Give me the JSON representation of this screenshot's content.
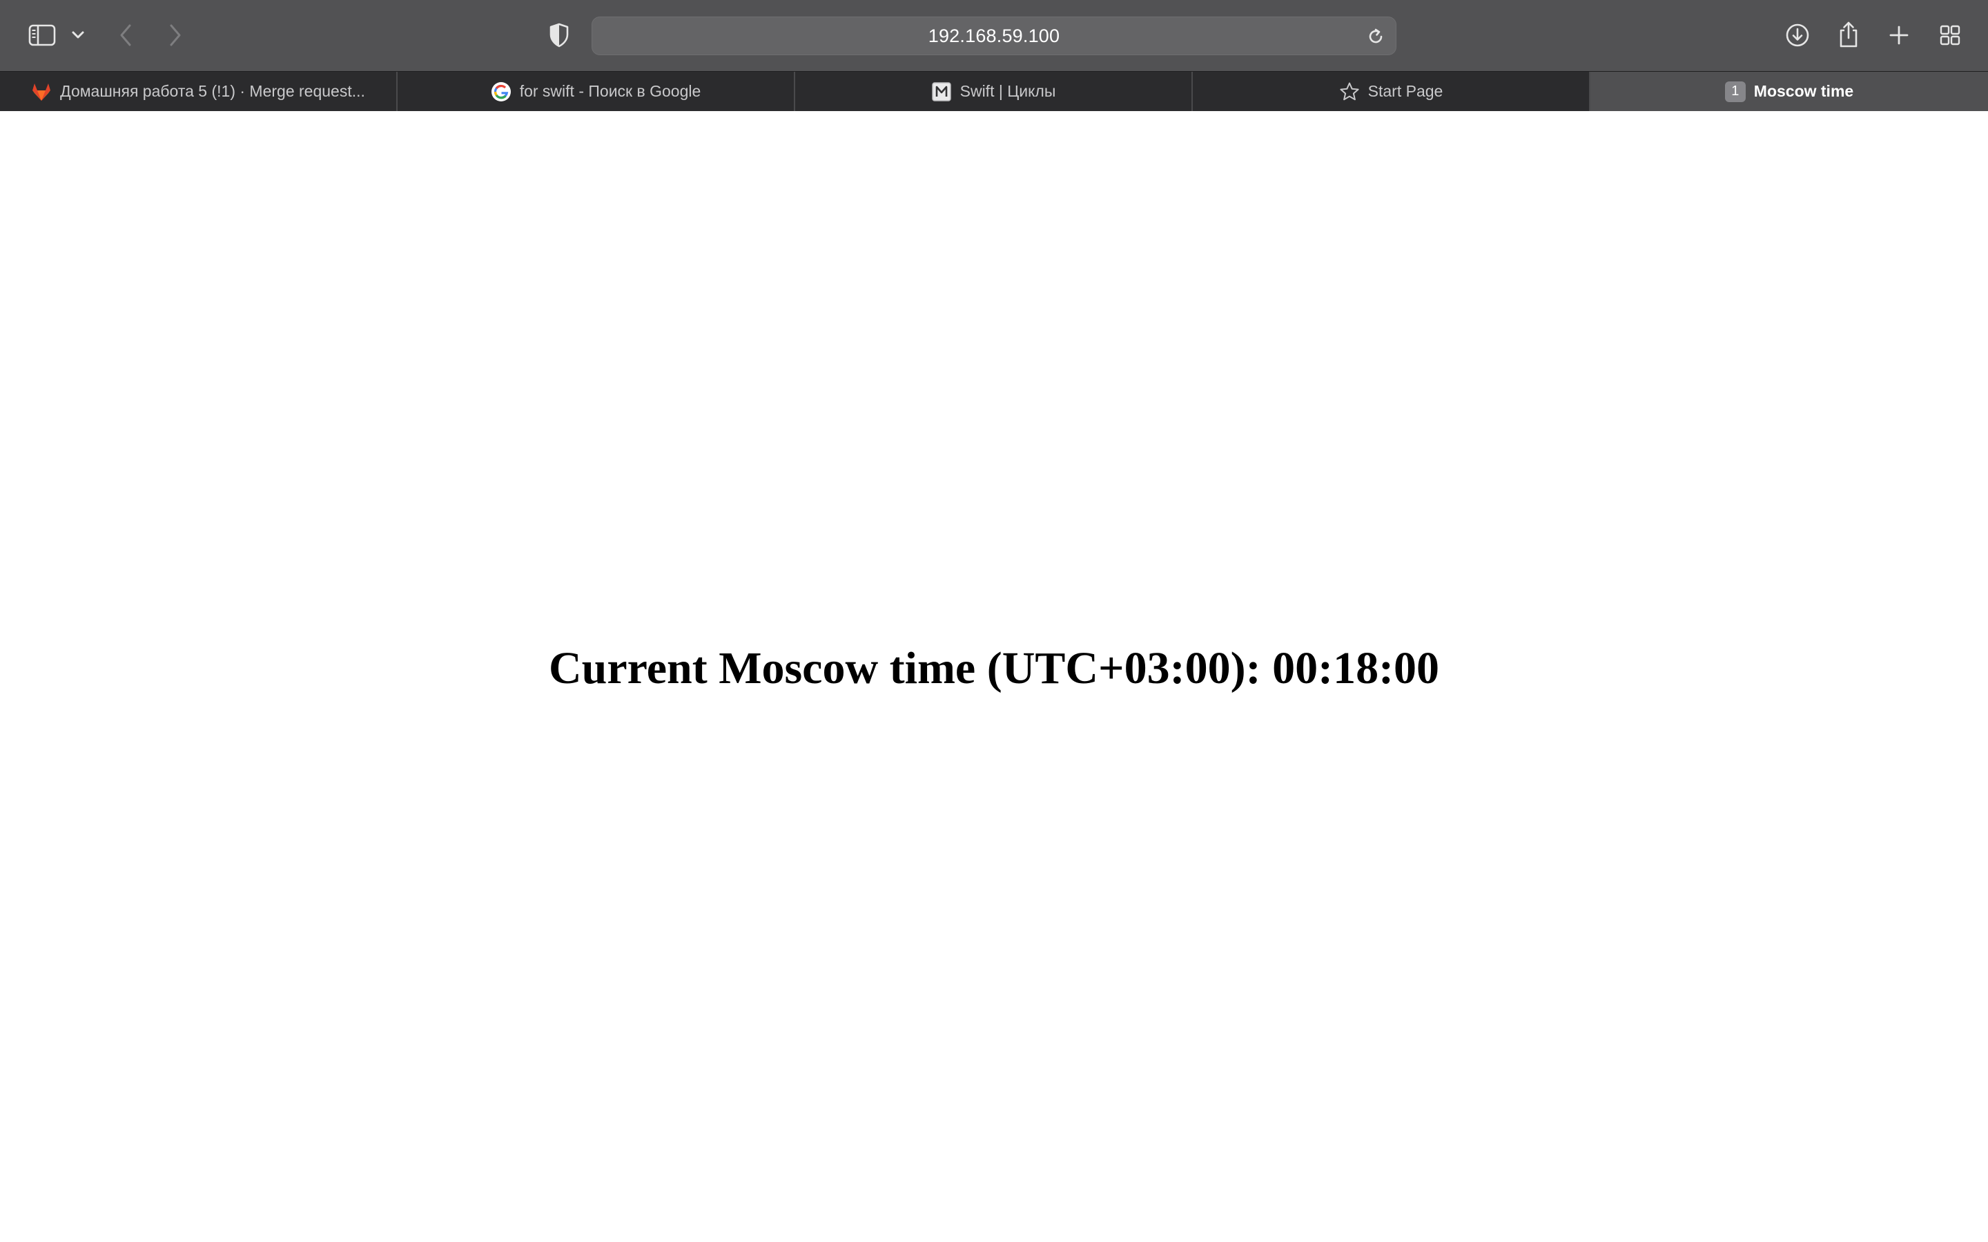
{
  "toolbar": {
    "address": "192.168.59.100"
  },
  "tabs": [
    {
      "label": "Домашняя работа 5 (!1) · Merge request...",
      "favicon": "gitlab-icon"
    },
    {
      "label": "for swift - Поиск в Google",
      "favicon": "google-icon"
    },
    {
      "label": "Swift | Циклы",
      "favicon": "metanit-icon"
    },
    {
      "label": "Start Page",
      "favicon": "star-icon"
    },
    {
      "label": "Moscow time",
      "badge": "1",
      "active": true
    }
  ],
  "page": {
    "heading": "Current Moscow time (UTC+03:00): 00:18:00"
  },
  "colors": {
    "toolbar_bg": "#525254",
    "tabbar_bg": "#2b2b2d",
    "active_tab_bg": "#505052",
    "page_bg": "#ffffff"
  }
}
